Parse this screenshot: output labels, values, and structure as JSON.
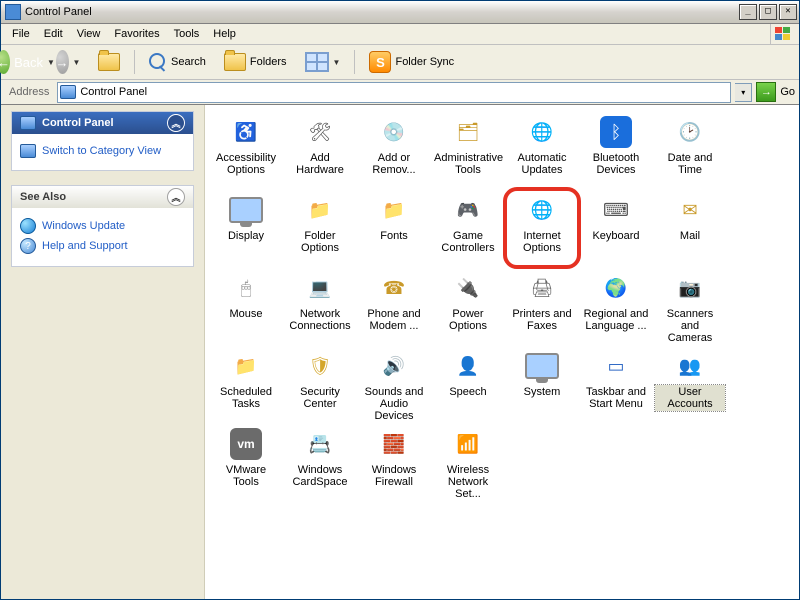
{
  "window": {
    "title": "Control Panel"
  },
  "menu": [
    "File",
    "Edit",
    "View",
    "Favorites",
    "Tools",
    "Help"
  ],
  "toolbar": {
    "back": "Back",
    "search": "Search",
    "folders": "Folders",
    "foldersync": "Folder Sync"
  },
  "address": {
    "label": "Address",
    "value": "Control Panel",
    "go": "Go"
  },
  "sidebar": {
    "panel1": {
      "title": "Control Panel",
      "links": [
        {
          "id": "switch-view",
          "label": "Switch to Category View"
        }
      ]
    },
    "panel2": {
      "title": "See Also",
      "links": [
        {
          "id": "windows-update",
          "label": "Windows Update"
        },
        {
          "id": "help-support",
          "label": "Help and Support"
        }
      ]
    }
  },
  "items": [
    {
      "id": "accessibility-options",
      "label": "Accessibility Options",
      "glyph": "♿",
      "fg": "#2f9e2f"
    },
    {
      "id": "add-hardware",
      "label": "Add Hardware",
      "glyph": "🛠",
      "fg": "#555"
    },
    {
      "id": "add-remove",
      "label": "Add or Remov...",
      "glyph": "💿",
      "fg": "#555"
    },
    {
      "id": "admin-tools",
      "label": "Administrative Tools",
      "glyph": "🗂",
      "fg": "#c99a2a"
    },
    {
      "id": "auto-updates",
      "label": "Automatic Updates",
      "glyph": "🌐",
      "fg": "#2a8ac9"
    },
    {
      "id": "bluetooth",
      "label": "Bluetooth Devices",
      "glyph": "ᛒ",
      "fg": "#fff",
      "bg": "#1a6edc"
    },
    {
      "id": "date-time",
      "label": "Date and Time",
      "glyph": "🕑",
      "fg": "#555"
    },
    {
      "id": "display",
      "label": "Display",
      "mon": true
    },
    {
      "id": "folder-options",
      "label": "Folder Options",
      "glyph": "📁",
      "fg": "#c99a2a"
    },
    {
      "id": "fonts",
      "label": "Fonts",
      "glyph": "📁",
      "fg": "#c99a2a"
    },
    {
      "id": "game-controllers",
      "label": "Game Controllers",
      "glyph": "🎮",
      "fg": "#666"
    },
    {
      "id": "internet-options",
      "label": "Internet Options",
      "glyph": "🌐",
      "fg": "#2a8ac9",
      "highlight": true
    },
    {
      "id": "keyboard",
      "label": "Keyboard",
      "glyph": "⌨",
      "fg": "#555"
    },
    {
      "id": "mail",
      "label": "Mail",
      "glyph": "✉",
      "fg": "#c99a2a"
    },
    {
      "id": "mouse",
      "label": "Mouse",
      "glyph": "🖱",
      "fg": "#888"
    },
    {
      "id": "network-connections",
      "label": "Network Connections",
      "glyph": "💻",
      "fg": "#555"
    },
    {
      "id": "phone-modem",
      "label": "Phone and Modem ...",
      "glyph": "☎",
      "fg": "#c99a2a"
    },
    {
      "id": "power-options",
      "label": "Power Options",
      "glyph": "🔌",
      "fg": "#555"
    },
    {
      "id": "printers-faxes",
      "label": "Printers and Faxes",
      "glyph": "🖨",
      "fg": "#666"
    },
    {
      "id": "regional",
      "label": "Regional and Language ...",
      "glyph": "🌍",
      "fg": "#2a8ac9"
    },
    {
      "id": "scanners-cameras",
      "label": "Scanners and Cameras",
      "glyph": "📷",
      "fg": "#c99a2a"
    },
    {
      "id": "scheduled-tasks",
      "label": "Scheduled Tasks",
      "glyph": "📁",
      "fg": "#c99a2a"
    },
    {
      "id": "security-center",
      "label": "Security Center",
      "glyph": "🛡",
      "fg": "#d4a62a"
    },
    {
      "id": "sounds",
      "label": "Sounds and Audio Devices",
      "glyph": "🔊",
      "fg": "#888"
    },
    {
      "id": "speech",
      "label": "Speech",
      "glyph": "👤",
      "fg": "#6aa0e0"
    },
    {
      "id": "system",
      "label": "System",
      "mon": true
    },
    {
      "id": "taskbar",
      "label": "Taskbar and Start Menu",
      "glyph": "▭",
      "fg": "#316ac5"
    },
    {
      "id": "user-accounts",
      "label": "User Accounts",
      "glyph": "👥",
      "fg": "#d08a2a",
      "selected": true
    },
    {
      "id": "vmware-tools",
      "label": "VMware Tools",
      "glyph": "vm",
      "fg": "#fff",
      "bg": "#6b6b6b",
      "small": true
    },
    {
      "id": "windows-cardspace",
      "label": "Windows CardSpace",
      "glyph": "📇",
      "fg": "#4a8bd6"
    },
    {
      "id": "windows-firewall",
      "label": "Windows Firewall",
      "glyph": "🧱",
      "fg": "#c9502a"
    },
    {
      "id": "wireless",
      "label": "Wireless Network Set...",
      "glyph": "📶",
      "fg": "#3c9a1c"
    }
  ]
}
